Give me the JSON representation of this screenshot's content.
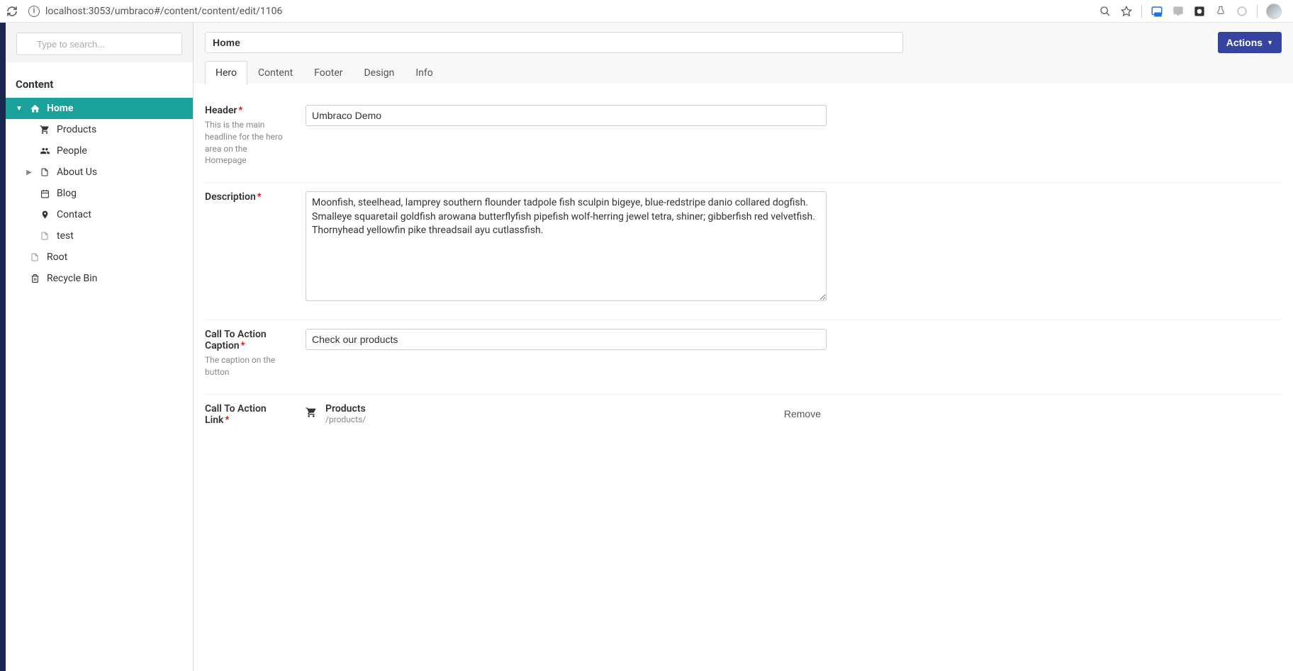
{
  "browser": {
    "url": "localhost:3053/umbraco#/content/content/edit/1106"
  },
  "search": {
    "placeholder": "Type to search..."
  },
  "sidebar": {
    "section_title": "Content",
    "home": {
      "label": "Home"
    },
    "children": [
      {
        "label": "Products",
        "icon": "cart"
      },
      {
        "label": "People",
        "icon": "people"
      },
      {
        "label": "About Us",
        "icon": "doc",
        "has_children": true
      },
      {
        "label": "Blog",
        "icon": "calendar"
      },
      {
        "label": "Contact",
        "icon": "pin"
      },
      {
        "label": "test",
        "icon": "doc"
      }
    ],
    "root": {
      "label": "Root"
    },
    "recycle": {
      "label": "Recycle Bin"
    }
  },
  "page": {
    "title_value": "Home",
    "actions_label": "Actions"
  },
  "tabs": [
    {
      "label": "Hero",
      "active": true
    },
    {
      "label": "Content"
    },
    {
      "label": "Footer"
    },
    {
      "label": "Design"
    },
    {
      "label": "Info"
    }
  ],
  "fields": {
    "header": {
      "label": "Header",
      "help": "This is the main headline for the hero area on the Homepage",
      "value": "Umbraco Demo"
    },
    "description": {
      "label": "Description",
      "value": "Moonfish, steelhead, lamprey southern flounder tadpole fish sculpin bigeye, blue-redstripe danio collared dogfish. Smalleye squaretail goldfish arowana butterflyfish pipefish wolf-herring jewel tetra, shiner; gibberfish red velvetfish. Thornyhead yellowfin pike threadsail ayu cutlassfish."
    },
    "cta_caption": {
      "label": "Call To Action Caption",
      "help": "The caption on the button",
      "value": "Check our products"
    },
    "cta_link": {
      "label": "Call To Action Link",
      "link_title": "Products",
      "link_path": "/products/",
      "remove_label": "Remove"
    }
  }
}
